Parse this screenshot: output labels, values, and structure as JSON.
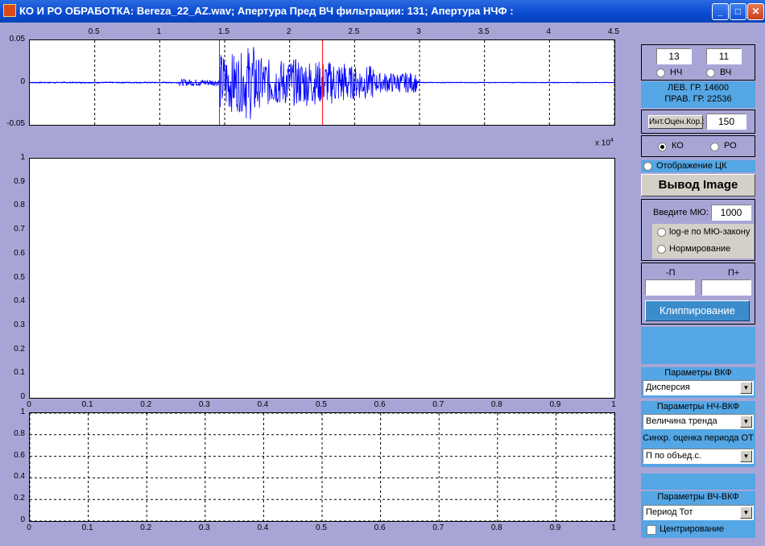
{
  "window": {
    "title": "КО И РО ОБРАБОТКА: Bereza_22_AZ.wav;  Апертура Пред ВЧ фильтрации: 131;  Апертура НЧФ :",
    "buttons": {
      "minimize": "_",
      "maximize": "□",
      "close": "✕"
    }
  },
  "waveform": {
    "xticks": [
      "0.5",
      "1",
      "1.5",
      "2",
      "2.5",
      "3",
      "3.5",
      "4",
      "4.5"
    ],
    "yticks": [
      "0.05",
      "0",
      "-0.05"
    ],
    "exponent_label": "x 10",
    "exponent_power": "4",
    "xlim": [
      0,
      45000
    ],
    "ylim": [
      -0.05,
      0.05
    ],
    "markers": [
      14600,
      22536
    ],
    "colors": {
      "signal": "#0000ff",
      "marker": "#ff0000"
    }
  },
  "middle_axes": {
    "yticks": [
      "1",
      "0.9",
      "0.8",
      "0.7",
      "0.6",
      "0.5",
      "0.4",
      "0.3",
      "0.2",
      "0.1",
      "0"
    ],
    "xticks": [
      "0",
      "0.1",
      "0.2",
      "0.3",
      "0.4",
      "0.5",
      "0.6",
      "0.7",
      "0.8",
      "0.9",
      "1"
    ]
  },
  "bottom_axes": {
    "yticks": [
      "1",
      "0.8",
      "0.6",
      "0.4",
      "0.2",
      "0"
    ],
    "xticks": [
      "0",
      "0.1",
      "0.2",
      "0.3",
      "0.4",
      "0.5",
      "0.6",
      "0.7",
      "0.8",
      "0.9",
      "1"
    ]
  },
  "controls": {
    "lf_value": "13",
    "hf_value": "11",
    "lf_label": "НЧ",
    "hf_label": "ВЧ",
    "left_bound": "ЛЕВ. ГР.  14600",
    "right_bound": "ПРАВ. ГР.  22536",
    "int_corr_label": "Инт.Оцен.Кор.:",
    "int_corr_value": "150",
    "ko_label": "КО",
    "ro_label": "РО",
    "show_ck_label": "Отображение ЦК",
    "output_image_label": "Вывод Image",
    "mu_label": "Введите МЮ:",
    "mu_value": "1000",
    "log_mu_label": "log-е по МЮ-закону",
    "normalize_label": "Нормирование",
    "minus_p_label": "-П",
    "plus_p_label": "П+",
    "clip_label": "Клиппирование",
    "vkf_params_label": "Параметры ВКФ",
    "vkf_select": "Дисперсия",
    "lf_vkf_label": "Параметры НЧ-ВКФ",
    "lf_vkf_select": "Величина тренда",
    "sync_label": "Синхр. оценка периода ОТ",
    "sync_select": "П по объед.с.",
    "hf_vkf_label": "Параметры ВЧ-ВКФ",
    "hf_vkf_select": "Период Тот",
    "centering_label": "Центрирование"
  }
}
